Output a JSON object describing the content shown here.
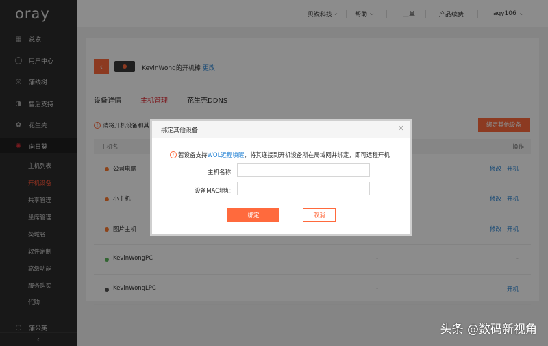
{
  "brand": {
    "logo": "oray"
  },
  "sidebar": {
    "items": [
      {
        "label": "总览",
        "icon": "grid-icon"
      },
      {
        "label": "用户中心",
        "icon": "user-icon"
      },
      {
        "label": "蒲线树",
        "icon": "target-icon"
      },
      {
        "label": "售后支持",
        "icon": "headset-icon"
      },
      {
        "label": "花生壳",
        "icon": "peanut-icon"
      },
      {
        "label": "向日葵",
        "icon": "sunflower-icon"
      }
    ],
    "sub_items": [
      {
        "label": "主机列表"
      },
      {
        "label": "开机设备"
      },
      {
        "label": "共享管理"
      },
      {
        "label": "坐席管理"
      },
      {
        "label": "葵域名"
      },
      {
        "label": "软件定制"
      },
      {
        "label": "高级功能"
      },
      {
        "label": "服务购买"
      },
      {
        "label": "代购"
      }
    ],
    "bottom_item": {
      "label": "蒲公英"
    },
    "collapse_icon": "chevron-left-icon"
  },
  "topbar": {
    "menus": [
      "贝锐科技",
      "帮助",
      "工单",
      "产品续费",
      "aqy106"
    ]
  },
  "device": {
    "name": "KevinWong的开机棒",
    "edit_label": "更改"
  },
  "tabs": [
    {
      "label": "设备详情",
      "active": false
    },
    {
      "label": "主机管理",
      "active": true
    },
    {
      "label": "花生壳DDNS",
      "active": false
    }
  ],
  "notice": {
    "text": "请将开机设备和其"
  },
  "bind_other_button": "绑定其他设备",
  "table": {
    "columns": {
      "name": "主机名",
      "ops": "操作"
    },
    "rows": [
      {
        "name": "公司电脑",
        "status_color": "#ff7a2e",
        "mid": "",
        "ops": [
          "修改",
          "开机"
        ]
      },
      {
        "name": "小主机",
        "status_color": "#ff7a2e",
        "mid": "",
        "ops": [
          "修改",
          "开机"
        ]
      },
      {
        "name": "图片主机",
        "status_color": "#ff7a2e",
        "mid": "",
        "ops": [
          "修改",
          "开机"
        ]
      },
      {
        "name": "KevinWongPC",
        "status_color": "#5cb85c",
        "mid": "-",
        "ops": [
          "-"
        ]
      },
      {
        "name": "KevinWongLPC",
        "status_color": "#555555",
        "mid": "-",
        "ops": [
          "开机"
        ]
      }
    ]
  },
  "modal": {
    "title": "绑定其他设备",
    "tip_prefix": "若设备支持",
    "tip_link": "WOL远程唤醒",
    "tip_suffix": "，将其连接到开机设备所在局域网并绑定，即可远程开机",
    "host_label": "主机名称:",
    "host_value": "",
    "mac_label": "设备MAC地址:",
    "mac_value": "",
    "bind_button": "绑定",
    "cancel_button": "取消"
  },
  "watermark": "头条 @数码新视角",
  "colors": {
    "accent": "#ff6a3d",
    "link": "#2a86d6",
    "active_tab": "#e0303a"
  }
}
